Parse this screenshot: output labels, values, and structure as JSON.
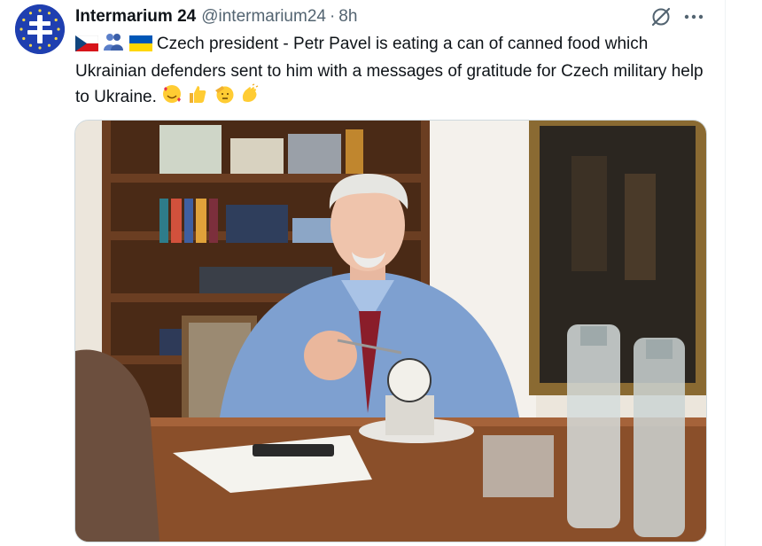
{
  "tweet": {
    "display_name": "Intermarium 24",
    "handle": "@intermarium24",
    "separator": "·",
    "time": "8h",
    "text": "Czech president - Petr Pavel is eating a can of canned food which Ukrainian defenders sent to him with a messages of gratitude for Czech military help to Ukraine.",
    "leading_emojis": [
      "czech-flag",
      "people-hugging",
      "ukraine-flag"
    ],
    "trailing_emojis": [
      "smiling-face-with-hearts",
      "thumbs-up",
      "saluting-face",
      "clapping-hands"
    ]
  },
  "icons": {
    "avatar": "intermarium-cross-logo",
    "grok": "grok-icon",
    "more": "more-icon"
  },
  "colors": {
    "avatar_bg": "#1f3fb0",
    "text": "#0f1419",
    "secondary": "#536471"
  }
}
